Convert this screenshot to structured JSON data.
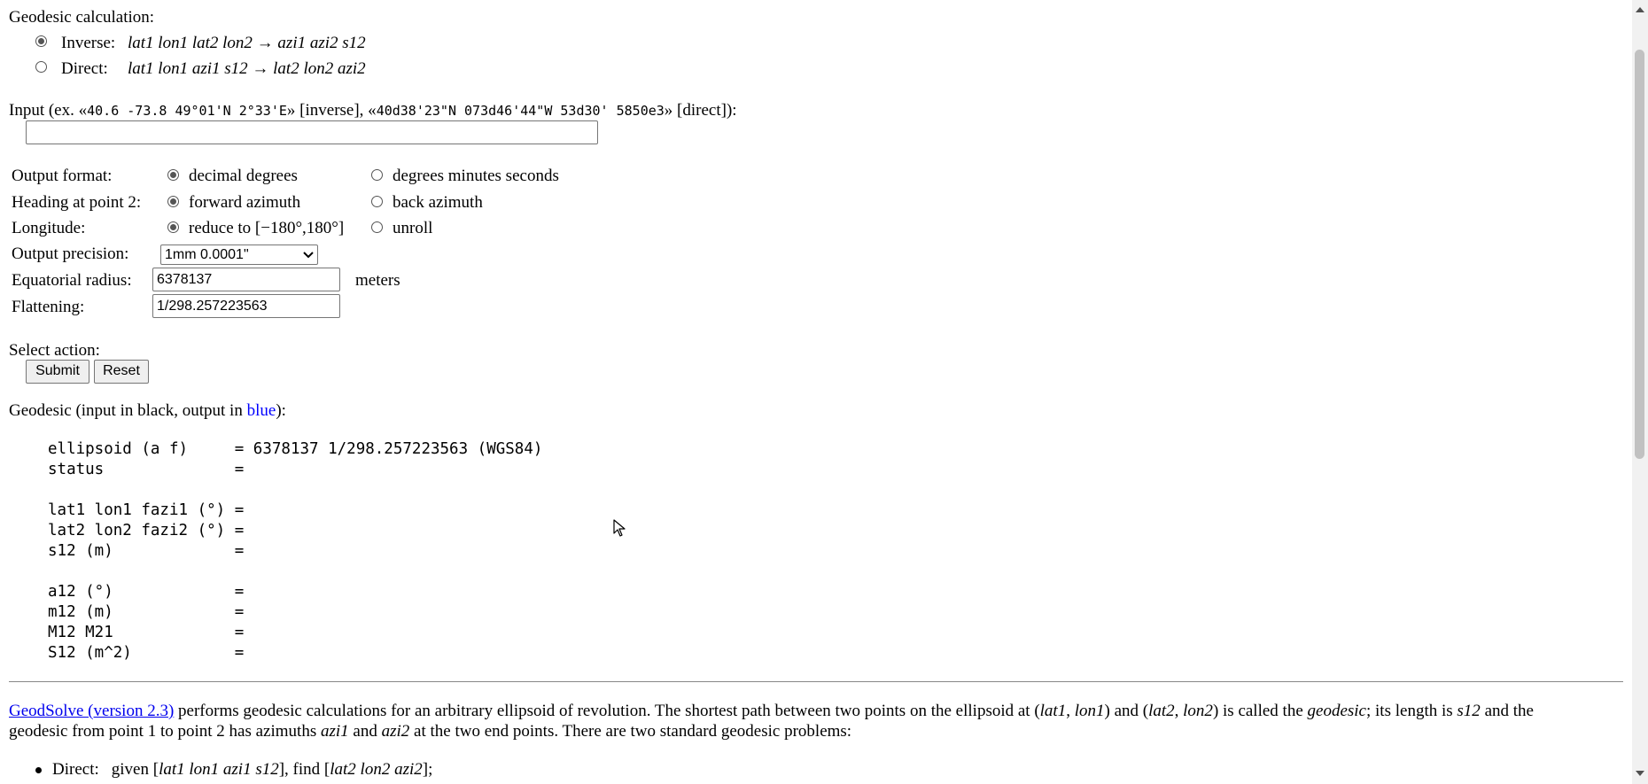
{
  "form": {
    "geodesic_calc_label": "Geodesic calculation:",
    "inverse": {
      "label": "Inverse:",
      "formula": "lat1 lon1 lat2 lon2 → azi1 azi2 s12",
      "checked": true
    },
    "direct": {
      "label": "Direct:",
      "formula": "lat1 lon1 azi1 s12  → lat2 lon2 azi2",
      "checked": false
    },
    "input_label_prefix": "Input (ex. «",
    "input_example_inverse": "40.6 -73.8 49°01'N 2°33'E",
    "input_label_mid": "» [inverse], «",
    "input_example_direct": "40d38'23\"N 073d46'44\"W 53d30' 5850e3",
    "input_label_suffix": "» [direct]):",
    "input_value": "",
    "output_format": {
      "label": "Output format:",
      "option1": "decimal degrees",
      "option2": "degrees minutes seconds"
    },
    "heading": {
      "label": "Heading at point 2:",
      "option1": "forward azimuth",
      "option2": "back azimuth"
    },
    "longitude": {
      "label": "Longitude:",
      "option1": "reduce to [−180°,180°]",
      "option2": "unroll"
    },
    "precision": {
      "label": "Output precision:",
      "selected": "1mm 0.0001\""
    },
    "radius": {
      "label": "Equatorial radius:",
      "value": "6378137",
      "unit": "meters"
    },
    "flattening": {
      "label": "Flattening:",
      "value": "1/298.257223563"
    },
    "select_action_label": "Select action:",
    "submit_label": "Submit",
    "reset_label": "Reset"
  },
  "results": {
    "header_prefix": "Geodesic (input in black, output in ",
    "header_blue": "blue",
    "header_suffix": "):",
    "rows": [
      {
        "key": "ellipsoid (a f)     =",
        "value": " 6378137 1/298.257223563 (WGS84)"
      },
      {
        "key": "status              =",
        "value": ""
      },
      {
        "key": "lat1 lon1 fazi1 (°) =",
        "value": ""
      },
      {
        "key": "lat2 lon2 fazi2 (°) =",
        "value": ""
      },
      {
        "key": "s12 (m)             =",
        "value": ""
      },
      {
        "key": "a12 (°)             =",
        "value": ""
      },
      {
        "key": "m12 (m)             =",
        "value": ""
      },
      {
        "key": "M12 M21             =",
        "value": ""
      },
      {
        "key": "S12 (m^2)           =",
        "value": ""
      }
    ]
  },
  "description": {
    "link_text": "GeodSolve (version 2.3)",
    "line1_a": " performs geodesic calculations for an arbitrary ellipsoid of revolution. The shortest path between two points on the ellipsoid at (",
    "lat1": "lat1",
    "comma1": ", ",
    "lon1": "lon1",
    "and": ") and (",
    "lat2": "lat2",
    "comma2": ", ",
    "lon2": "lon2",
    "called": ") is called the ",
    "geodesic": "geodesic",
    "length": "; its length is ",
    "s12": "s12",
    "and_the": " and the",
    "line2_a": "geodesic from point 1 to point 2 has azimuths ",
    "azi1": "azi1",
    "and2": " and ",
    "azi2": "azi2",
    "line2_b": " at the two end points. There are two standard geodesic problems:",
    "bullet1_label": "Direct:",
    "bullet1_a": "given [",
    "bullet1_given": "lat1 lon1 azi1 s12",
    "bullet1_b": "], find [",
    "bullet1_find": "lat2 lon2 azi2",
    "bullet1_c": "];"
  }
}
